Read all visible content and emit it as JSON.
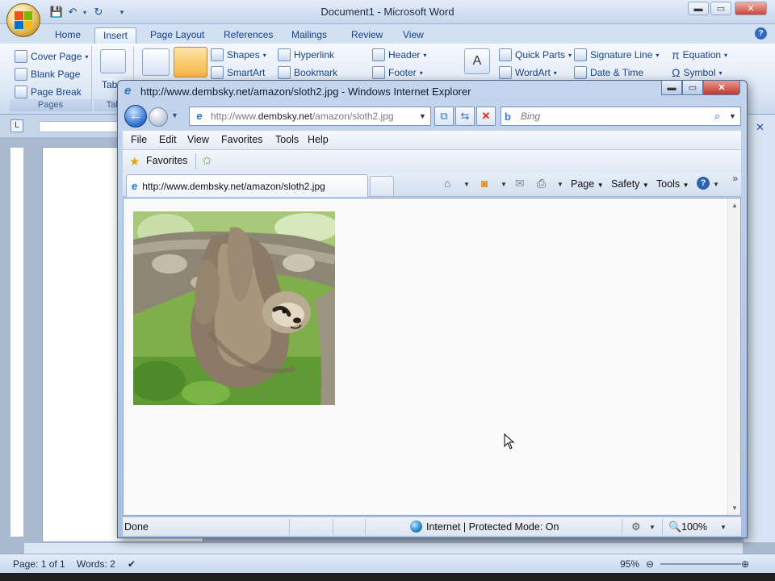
{
  "word": {
    "title": "Document1 - Microsoft Word",
    "window_buttons": {
      "minimize": "▬",
      "maximize": "▭",
      "close": "✕"
    },
    "tabs": [
      {
        "label": "Home",
        "active": false
      },
      {
        "label": "Insert",
        "active": true
      },
      {
        "label": "Page Layout",
        "active": false
      },
      {
        "label": "References",
        "active": false
      },
      {
        "label": "Mailings",
        "active": false
      },
      {
        "label": "Review",
        "active": false
      },
      {
        "label": "View",
        "active": false
      }
    ],
    "ribbon": {
      "pages_group": {
        "label": "Pages",
        "items": [
          "Cover Page",
          "Blank Page",
          "Page Break"
        ]
      },
      "tables_group": {
        "label": "Tab",
        "button": "Tab"
      },
      "illustrations": {
        "shapes": "Shapes",
        "smartart": "SmartArt"
      },
      "links": {
        "hyperlink": "Hyperlink",
        "bookmark": "Bookmark"
      },
      "header_footer": {
        "header": "Header",
        "footer": "Footer"
      },
      "text": {
        "quick_parts": "Quick Parts",
        "wordart": "WordArt",
        "signature_line": "Signature Line",
        "date_time": "Date & Time"
      },
      "symbols": {
        "equation": "Equation",
        "symbol": "Symbol"
      }
    },
    "status": {
      "page": "Page: 1 of 1",
      "words": "Words: 2",
      "zoom": "95%"
    }
  },
  "ie": {
    "title": "http://www.dembsky.net/amazon/sloth2.jpg - Windows Internet Explorer",
    "address": {
      "prefix": "http://www.",
      "domain": "dembsky.net",
      "path": "/amazon/sloth2.jpg"
    },
    "search_placeholder": "Bing",
    "menu": [
      "File",
      "Edit",
      "View",
      "Favorites",
      "Tools",
      "Help"
    ],
    "favorites_label": "Favorites",
    "tab_label": "http://www.dembsky.net/amazon/sloth2.jpg",
    "commands": {
      "page": "Page",
      "safety": "Safety",
      "tools": "Tools"
    },
    "status": {
      "text": "Done",
      "zone": "Internet | Protected Mode: On",
      "zoom": "100%"
    },
    "icons": [
      "back-icon",
      "forward-icon",
      "refresh-icon",
      "stop-icon",
      "home-icon",
      "feeds-icon",
      "mail-icon",
      "print-icon",
      "help-icon",
      "search-icon"
    ]
  },
  "colors": {
    "ie_blue": "#2a73c9",
    "word_ribbon": "#dce7f5",
    "close_red": "#c2382b"
  }
}
